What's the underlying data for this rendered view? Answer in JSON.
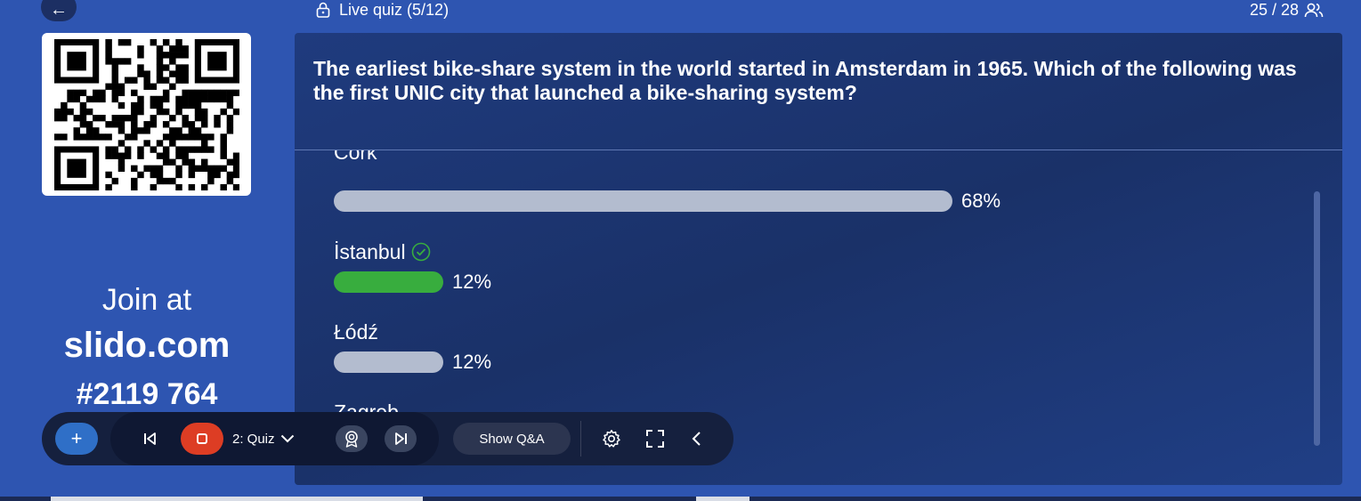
{
  "header": {
    "back_icon": "arrow-left-icon",
    "title": "Live quiz (5/12)",
    "title_icon": "lock-icon",
    "participants": "25 / 28",
    "participants_icon": "people-icon"
  },
  "join": {
    "line1": "Join at",
    "host": "slido.com",
    "code": "#2119 764",
    "qr_icon": "qr-code"
  },
  "question": {
    "text": "The earliest bike-share system in the world started in Amsterdam in 1965. Which of the following was the first UNIC city that launched a bike-sharing system?"
  },
  "options": [
    {
      "label": "Cork",
      "percent": 68,
      "percent_label": "68%",
      "correct": false
    },
    {
      "label": "İstanbul",
      "percent": 12,
      "percent_label": "12%",
      "correct": true
    },
    {
      "label": "Łódź",
      "percent": 12,
      "percent_label": "12%",
      "correct": false
    },
    {
      "label": "Zagreb",
      "percent": null,
      "percent_label": "",
      "correct": false
    }
  ],
  "toolbar": {
    "quiz_label": "2: Quiz",
    "qa_label": "Show Q&A"
  },
  "colors": {
    "background": "#2e55b1",
    "panel": "#1c356f",
    "bar": "#b3bccf",
    "correct_bar": "#38ad3e",
    "stop": "#dd3d24",
    "add": "#2f6fc7"
  }
}
